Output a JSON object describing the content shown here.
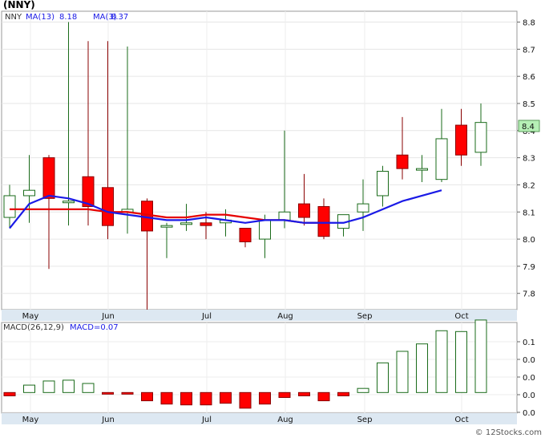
{
  "header": {
    "title": "(NNY)",
    "legend_symbol": "NNY",
    "ma13_label": "MA(13)",
    "ma13_value": "8.18",
    "ma3_label": "MA(3)",
    "ma3_value": "8.37",
    "macd_params": "MACD(26,12,9)",
    "macd_value": "MACD=0.07",
    "last_price_badge": "8.4",
    "copyright": "© 12Stocks.com"
  },
  "colors": {
    "up": "#1a6b1a",
    "down": "#ff0000",
    "ma13": "#1a1ae6",
    "ma3": "#e60000",
    "axis_bg": "#dde8f2",
    "badge_bg": "#b6f0b6"
  },
  "chart_data": [
    {
      "type": "candlestick",
      "x_months": [
        "May",
        "Jun",
        "Jul",
        "Aug",
        "Sep",
        "Oct"
      ],
      "y_ticks": [
        "8.8",
        "8.7",
        "8.6",
        "8.5",
        "8.4",
        "8.3",
        "8.2",
        "8.1",
        "8.0",
        "7.9",
        "7.8"
      ],
      "ylim": [
        7.74,
        8.84
      ],
      "candles": [
        {
          "date": "Apr 19",
          "o": 8.08,
          "h": 8.2,
          "l": 8.04,
          "c": 8.16
        },
        {
          "date": "Apr 26",
          "o": 8.16,
          "h": 8.31,
          "l": 8.06,
          "c": 8.18
        },
        {
          "date": "May 3",
          "o": 8.3,
          "h": 8.31,
          "l": 7.89,
          "c": 8.15
        },
        {
          "date": "May 10",
          "o": 8.14,
          "h": 8.8,
          "l": 8.05,
          "c": 8.14
        },
        {
          "date": "May 17",
          "o": 8.23,
          "h": 8.73,
          "l": 8.05,
          "c": 8.12
        },
        {
          "date": "May 24",
          "o": 8.19,
          "h": 8.73,
          "l": 8.0,
          "c": 8.05
        },
        {
          "date": "May 31",
          "o": 8.1,
          "h": 8.71,
          "l": 8.02,
          "c": 8.11
        },
        {
          "date": "Jun 7",
          "o": 8.14,
          "h": 8.15,
          "l": 7.74,
          "c": 8.03
        },
        {
          "date": "Jun 14",
          "o": 8.05,
          "h": 8.06,
          "l": 7.93,
          "c": 8.05
        },
        {
          "date": "Jun 21",
          "o": 8.06,
          "h": 8.13,
          "l": 8.03,
          "c": 8.06
        },
        {
          "date": "Jun 28",
          "o": 8.06,
          "h": 8.1,
          "l": 8.0,
          "c": 8.05
        },
        {
          "date": "Jul 5",
          "o": 8.06,
          "h": 8.11,
          "l": 8.01,
          "c": 8.07
        },
        {
          "date": "Jul 12",
          "o": 8.04,
          "h": 8.04,
          "l": 7.97,
          "c": 7.99
        },
        {
          "date": "Jul 19",
          "o": 8.0,
          "h": 8.09,
          "l": 7.93,
          "c": 8.07
        },
        {
          "date": "Jul 26",
          "o": 8.07,
          "h": 8.4,
          "l": 8.04,
          "c": 8.1
        },
        {
          "date": "Aug 2",
          "o": 8.13,
          "h": 8.24,
          "l": 8.05,
          "c": 8.08
        },
        {
          "date": "Aug 9",
          "o": 8.12,
          "h": 8.15,
          "l": 8.0,
          "c": 8.01
        },
        {
          "date": "Aug 16",
          "o": 8.04,
          "h": 8.09,
          "l": 8.01,
          "c": 8.09
        },
        {
          "date": "Aug 23",
          "o": 8.1,
          "h": 8.22,
          "l": 8.03,
          "c": 8.13
        },
        {
          "date": "Aug 30",
          "o": 8.16,
          "h": 8.27,
          "l": 8.12,
          "c": 8.25
        },
        {
          "date": "Sep 6",
          "o": 8.31,
          "h": 8.45,
          "l": 8.22,
          "c": 8.26
        },
        {
          "date": "Sep 13",
          "o": 8.26,
          "h": 8.31,
          "l": 8.21,
          "c": 8.26
        },
        {
          "date": "Sep 20",
          "o": 8.22,
          "h": 8.48,
          "l": 8.21,
          "c": 8.37
        },
        {
          "date": "Sep 27",
          "o": 8.42,
          "h": 8.48,
          "l": 8.27,
          "c": 8.31
        },
        {
          "date": "Oct 4",
          "o": 8.32,
          "h": 8.5,
          "l": 8.27,
          "c": 8.43
        }
      ],
      "series": [
        {
          "name": "MA(13)",
          "values": [
            8.04,
            8.13,
            8.16,
            8.15,
            8.13,
            8.1,
            8.09,
            8.08,
            8.07,
            8.07,
            8.08,
            8.07,
            8.06,
            8.07,
            8.07,
            8.06,
            8.06,
            8.06,
            8.08,
            8.11,
            8.14,
            8.16,
            8.18
          ]
        },
        {
          "name": "MA(3)",
          "values": [
            8.11,
            8.11,
            8.11,
            8.11,
            8.11,
            8.1,
            8.1,
            8.09,
            8.08,
            8.08,
            8.09,
            8.09,
            8.08,
            8.07,
            8.07,
            8.06,
            8.06
          ]
        }
      ]
    },
    {
      "type": "bar",
      "title": "MACD(26,12,9)",
      "y_ticks": [
        "0.1",
        "0.0",
        "0.0",
        "0.0",
        "0.0"
      ],
      "ylim": [
        -0.05,
        0.17
      ],
      "values": [
        -0.008,
        0.018,
        0.028,
        0.03,
        0.022,
        -0.002,
        -0.002,
        -0.02,
        -0.028,
        -0.03,
        -0.03,
        -0.026,
        -0.038,
        -0.028,
        -0.012,
        -0.008,
        -0.02,
        -0.008,
        0.01,
        0.072,
        0.1,
        0.118,
        0.15,
        0.148,
        0.176
      ]
    }
  ]
}
